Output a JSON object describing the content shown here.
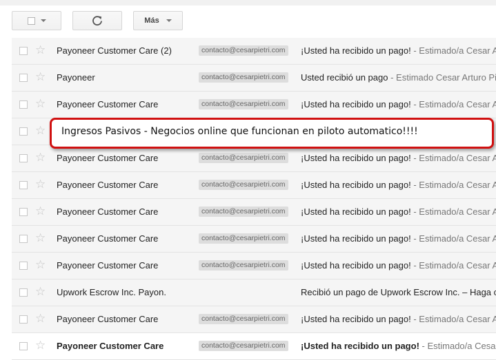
{
  "toolbar": {
    "more_label": "Más",
    "refresh_icon": "refresh-icon",
    "select_icon": "checkbox-select-icon"
  },
  "emails": [
    {
      "sender": "Payoneer Customer Care (2)",
      "label": "contacto@cesarpietri.com",
      "subject": "¡Usted ha recibido un pago!",
      "snippet": " - Estimado/a Cesar Ar",
      "unread": false
    },
    {
      "sender": "Payoneer",
      "label": "contacto@cesarpietri.com",
      "subject": "Usted recibió un pago",
      "snippet": " - Estimado Cesar Arturo Pie",
      "unread": false
    },
    {
      "sender": "Payoneer Customer Care",
      "label": "contacto@cesarpietri.com",
      "subject": "¡Usted ha recibido un pago!",
      "snippet": " - Estimado/a Cesar Ar",
      "unread": false
    },
    {
      "sender": "",
      "label": "",
      "subject": "",
      "snippet": "",
      "unread": false
    },
    {
      "sender": "Payoneer Customer Care",
      "label": "contacto@cesarpietri.com",
      "subject": "¡Usted ha recibido un pago!",
      "snippet": " - Estimado/a Cesar Ar",
      "unread": false
    },
    {
      "sender": "Payoneer Customer Care",
      "label": "contacto@cesarpietri.com",
      "subject": "¡Usted ha recibido un pago!",
      "snippet": " - Estimado/a Cesar Ar",
      "unread": false
    },
    {
      "sender": "Payoneer Customer Care",
      "label": "contacto@cesarpietri.com",
      "subject": "¡Usted ha recibido un pago!",
      "snippet": " - Estimado/a Cesar Ar",
      "unread": false
    },
    {
      "sender": "Payoneer Customer Care",
      "label": "contacto@cesarpietri.com",
      "subject": "¡Usted ha recibido un pago!",
      "snippet": " - Estimado/a Cesar Ar",
      "unread": false
    },
    {
      "sender": "Payoneer Customer Care",
      "label": "contacto@cesarpietri.com",
      "subject": "¡Usted ha recibido un pago!",
      "snippet": " - Estimado/a Cesar Ar",
      "unread": false
    },
    {
      "sender": "Upwork Escrow Inc. Payon.",
      "label": "",
      "subject": "Recibió un pago de Upwork Escrow Inc. – Haga cl",
      "snippet": "",
      "unread": false
    },
    {
      "sender": "Payoneer Customer Care",
      "label": "contacto@cesarpietri.com",
      "subject": "¡Usted ha recibido un pago!",
      "snippet": " - Estimado/a Cesar Ar",
      "unread": false
    },
    {
      "sender": "Payoneer Customer Care",
      "label": "contacto@cesarpietri.com",
      "subject": "¡Usted ha recibido un pago!",
      "snippet": " - Estimado/a Cesar Ar",
      "unread": true
    }
  ],
  "callout": {
    "text": "Ingresos Pasivos - Negocios online que funcionan en piloto automatico!!!!",
    "border_color": "#d01010"
  },
  "colors": {
    "read_row_bg": "#f5f5f5",
    "unread_row_bg": "#ffffff",
    "label_bg": "#dddddd"
  }
}
